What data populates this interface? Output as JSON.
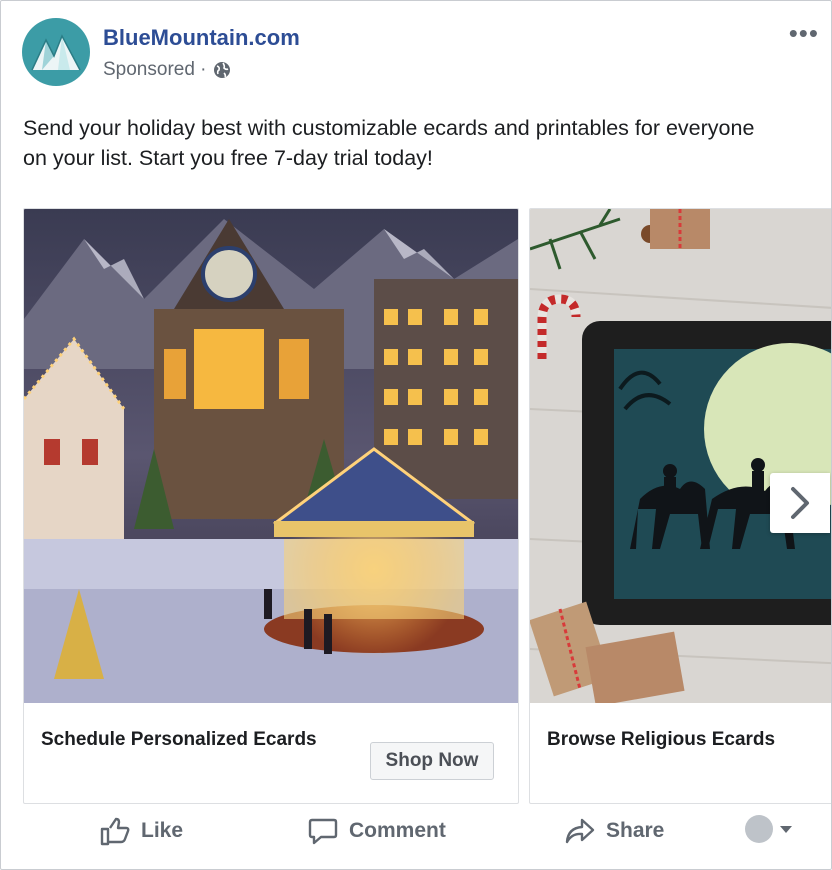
{
  "page": {
    "name": "BlueMountain.com",
    "sponsored": "Sponsored ·"
  },
  "post": {
    "text": "Send your holiday best with customizable ecards and printables for everyone on your list. Start you free 7-day trial today!"
  },
  "carousel": {
    "cards": [
      {
        "title": "Schedule Personalized Ecards",
        "button": "Shop Now"
      },
      {
        "title": "Browse Religious Ecards"
      }
    ]
  },
  "actions": {
    "like": "Like",
    "comment": "Comment",
    "share": "Share"
  },
  "colors": {
    "link": "#2d4d95",
    "avatar_bg": "#3c9ca6",
    "meta_gray": "#606770"
  },
  "icons": [
    "more-icon",
    "globe-icon",
    "like-icon",
    "comment-icon",
    "share-icon",
    "chevron-right-icon",
    "caret-down-icon"
  ]
}
